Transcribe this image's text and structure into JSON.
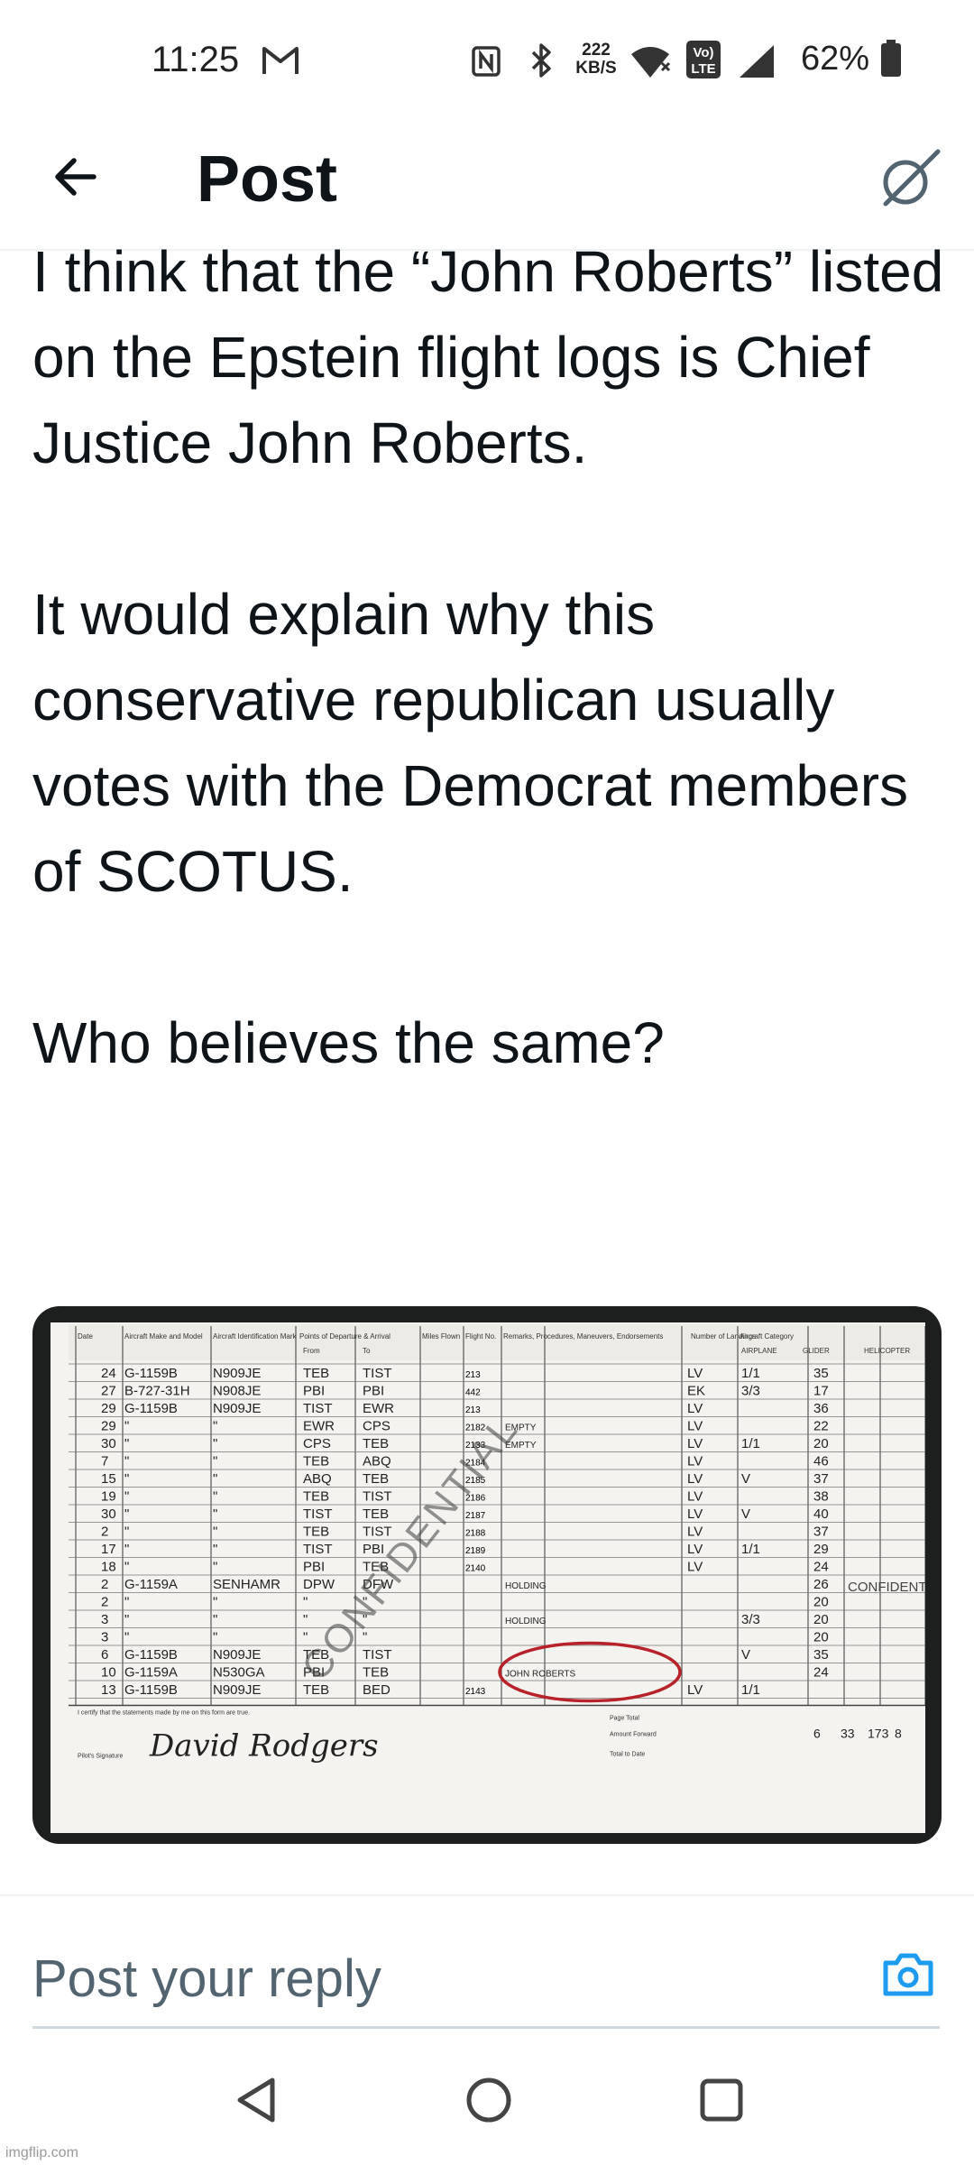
{
  "status_bar": {
    "time": "11:25",
    "net_speed_value": "222",
    "net_speed_unit": "KB/S",
    "volte_line1": "Vo)",
    "volte_line2": "LTE",
    "battery": "62%",
    "icons": [
      "gmail-icon",
      "nfc-icon",
      "bluetooth-icon",
      "wifi-icon",
      "volte-icon",
      "signal-icon",
      "battery-icon"
    ]
  },
  "header": {
    "title": "Post",
    "back_icon": "arrow-left-icon",
    "grok_icon": "grok-icon"
  },
  "post": {
    "text": "I think that the “John Roberts” listed on the Epstein flight logs is Chief Justice John Roberts.\n\nIt would explain why this conservative republican usually votes with the Democrat members of SCOTUS.\n\nWho believes the same?",
    "image": {
      "watermark_diag": "CONFIDENTIAL",
      "watermark_side": "CONFIDENTIA",
      "circled_name": "JOHN ROBERTS",
      "signature": "David Rodgers",
      "col_headers": [
        "Date",
        "Aircraft Make and Model",
        "Aircraft Identification Mark",
        "Points of Departure & Arrival",
        "Miles Flown",
        "Flight No.",
        "Remarks, Procedures, Maneuvers, Endorsements",
        "Number of Landings",
        "Aircraft Category"
      ],
      "from_label": "From",
      "to_label": "To",
      "category_headers": [
        "AIRPLANE",
        "GLIDER",
        "HELICOPTER"
      ],
      "rows": [
        {
          "date": "24",
          "make": "G-1159B",
          "tail": "N909JE",
          "from": "TEB",
          "to": "TIST",
          "miles": "213",
          "remarks": "",
          "lv": "LV",
          "landings": "1/1",
          "cat": "35"
        },
        {
          "date": "27",
          "make": "B-727-31H",
          "tail": "N908JE",
          "from": "PBI",
          "to": "PBI",
          "miles": "442",
          "remarks": "",
          "lv": "EK",
          "landings": "3/3",
          "cat": "17"
        },
        {
          "date": "29",
          "make": "G-1159B",
          "tail": "N909JE",
          "from": "TIST",
          "to": "EWR",
          "miles": "213",
          "remarks": "",
          "lv": "LV",
          "landings": "",
          "cat": "36"
        },
        {
          "date": "29",
          "make": "\"",
          "tail": "\"",
          "from": "EWR",
          "to": "CPS",
          "miles": "2182",
          "remarks": "EMPTY",
          "lv": "LV",
          "landings": "",
          "cat": "22"
        },
        {
          "date": "30",
          "make": "\"",
          "tail": "\"",
          "from": "CPS",
          "to": "TEB",
          "miles": "2133",
          "remarks": "EMPTY",
          "lv": "LV",
          "landings": "1/1",
          "cat": "20"
        },
        {
          "date": "7",
          "make": "\"",
          "tail": "\"",
          "from": "TEB",
          "to": "ABQ",
          "miles": "2184",
          "remarks": "",
          "lv": "LV",
          "landings": "",
          "cat": "46"
        },
        {
          "date": "15",
          "make": "\"",
          "tail": "\"",
          "from": "ABQ",
          "to": "TEB",
          "miles": "2185",
          "remarks": "",
          "lv": "LV",
          "landings": "V",
          "cat": "37"
        },
        {
          "date": "19",
          "make": "\"",
          "tail": "\"",
          "from": "TEB",
          "to": "TIST",
          "miles": "2186",
          "remarks": "",
          "lv": "LV",
          "landings": "",
          "cat": "38"
        },
        {
          "date": "30",
          "make": "\"",
          "tail": "\"",
          "from": "TIST",
          "to": "TEB",
          "miles": "2187",
          "remarks": "",
          "lv": "LV",
          "landings": "V",
          "cat": "40"
        },
        {
          "date": "2",
          "make": "\"",
          "tail": "\"",
          "from": "TEB",
          "to": "TIST",
          "miles": "2188",
          "remarks": "",
          "lv": "LV",
          "landings": "",
          "cat": "37"
        },
        {
          "date": "17",
          "make": "\"",
          "tail": "\"",
          "from": "TIST",
          "to": "PBI",
          "miles": "2189",
          "remarks": "",
          "lv": "LV",
          "landings": "1/1",
          "cat": "29"
        },
        {
          "date": "18",
          "make": "\"",
          "tail": "\"",
          "from": "PBI",
          "to": "TEB",
          "miles": "2140",
          "remarks": "",
          "lv": "LV",
          "landings": "",
          "cat": "24"
        },
        {
          "date": "2",
          "make": "G-1159A",
          "tail": "SENHAMR",
          "from": "DPW",
          "to": "DFW",
          "miles": "",
          "remarks": "HOLDING",
          "lv": "",
          "landings": "",
          "cat": "26"
        },
        {
          "date": "2",
          "make": "\"",
          "tail": "\"",
          "from": "\"",
          "to": "\"",
          "miles": "",
          "remarks": "",
          "lv": "",
          "landings": "",
          "cat": "20"
        },
        {
          "date": "3",
          "make": "\"",
          "tail": "\"",
          "from": "\"",
          "to": "\"",
          "miles": "",
          "remarks": "HOLDING",
          "lv": "",
          "landings": "3/3",
          "cat": "20"
        },
        {
          "date": "3",
          "make": "\"",
          "tail": "\"",
          "from": "\"",
          "to": "\"",
          "miles": "",
          "remarks": "",
          "lv": "",
          "landings": "",
          "cat": "20"
        },
        {
          "date": "6",
          "make": "G-1159B",
          "tail": "N909JE",
          "from": "TEB",
          "to": "TIST",
          "miles": "",
          "remarks": "",
          "lv": "",
          "landings": "V",
          "cat": "35"
        },
        {
          "date": "10",
          "make": "G-1159A",
          "tail": "N530GA",
          "from": "PBI",
          "to": "TEB",
          "miles": "",
          "remarks": "JOHN ROBERTS",
          "lv": "",
          "landings": "",
          "cat": "24"
        },
        {
          "date": "13",
          "make": "G-1159B",
          "tail": "N909JE",
          "from": "TEB",
          "to": "BED",
          "miles": "2143",
          "remarks": "",
          "lv": "LV",
          "landings": "1/1",
          "cat": ""
        }
      ],
      "footer_certify": "I certify that the statements made by me on this form are true.",
      "footer_pilot": "Pilot's Signature",
      "footer_page_total": "Page Total",
      "footer_amount_fwd": "Amount Forward",
      "footer_total_date": "Total to Date",
      "footer_vals": [
        "6",
        "33",
        "173",
        "8"
      ]
    }
  },
  "reply": {
    "placeholder": "Post your reply",
    "camera_icon": "camera-icon"
  },
  "navbar": {
    "icons": [
      "nav-back-icon",
      "nav-home-icon",
      "nav-recents-icon"
    ]
  },
  "watermark": "imgflip.com",
  "colors": {
    "text": "#0f1419",
    "secondary": "#536471",
    "accent": "#1d9bf0",
    "circle": "#b8222a"
  }
}
